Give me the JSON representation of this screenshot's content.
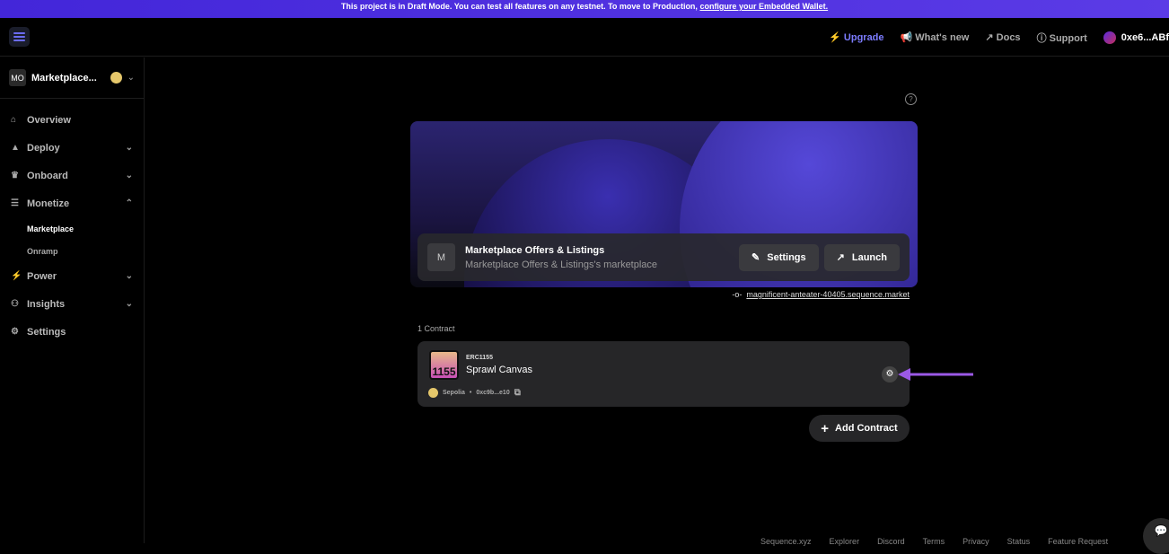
{
  "banner": {
    "text": "This project is in Draft Mode. You can test all features on any testnet. To move to Production, ",
    "link": "configure your Embedded Wallet."
  },
  "header": {
    "upgrade": "Upgrade",
    "whats_new": "What's new",
    "docs": "Docs",
    "support": "Support",
    "account": "0xe6...ABf"
  },
  "sidebar": {
    "project_initials": "MO",
    "project_name": "Marketplace...",
    "items": [
      {
        "label": "Overview"
      },
      {
        "label": "Deploy"
      },
      {
        "label": "Onboard"
      },
      {
        "label": "Monetize"
      },
      {
        "label": "Power"
      },
      {
        "label": "Insights"
      },
      {
        "label": "Settings"
      }
    ],
    "subitems": [
      {
        "label": "Marketplace"
      },
      {
        "label": "Onramp"
      }
    ]
  },
  "marketplace": {
    "initial": "M",
    "title": "Marketplace Offers & Listings",
    "subtitle": "Marketplace Offers & Listings's marketplace",
    "settings": "Settings",
    "launch": "Launch",
    "url": "magnificent-anteater-40405.sequence.market"
  },
  "contracts": {
    "count": "1 Contract",
    "items": [
      {
        "badge": "1155",
        "standard": "ERC1155",
        "name": "Sprawl Canvas",
        "network": "Sepolia",
        "address": "0xc9b...e10"
      }
    ],
    "add": "Add Contract"
  },
  "footer": [
    "Sequence.xyz",
    "Explorer",
    "Discord",
    "Terms",
    "Privacy",
    "Status",
    "Feature Request"
  ],
  "colors": {
    "banner": "#4326d9",
    "accent": "#7c7cff",
    "arrow": "#9b59e6"
  }
}
